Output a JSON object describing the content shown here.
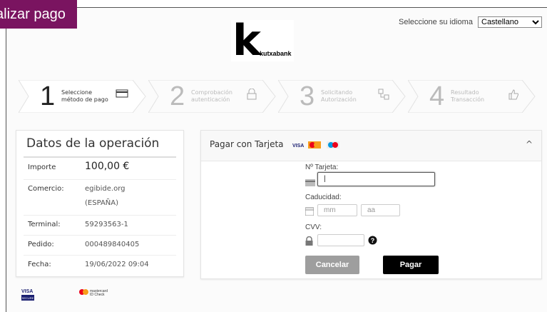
{
  "page": {
    "overlay_label": "alizar pago"
  },
  "language": {
    "label": "Seleccione su idioma",
    "selected": "Castellano"
  },
  "brand": {
    "logo_letter": "k",
    "logo_text": "kutxabank"
  },
  "steps": [
    {
      "num": "1",
      "label": "Seleccione\nmétodo de pago",
      "state": "active",
      "icon": "card-icon"
    },
    {
      "num": "2",
      "label": "Comprobación\nautenticación",
      "state": "inactive",
      "icon": "lock-icon"
    },
    {
      "num": "3",
      "label": "Solicitando\nAutorización",
      "state": "inactive",
      "icon": "network-icon"
    },
    {
      "num": "4",
      "label": "Resultado\nTransacción",
      "state": "inactive",
      "icon": "thumbs-up-icon"
    }
  ],
  "operation": {
    "title": "Datos de la operación",
    "rows": [
      {
        "key": "Importe",
        "value": "100,00 €"
      },
      {
        "key": "Comercio:",
        "value": "egibide.org",
        "value2": "(ESPAÑA)"
      },
      {
        "key": "Terminal:",
        "value": "59293563-1"
      },
      {
        "key": "Pedido:",
        "value": "000489840405"
      },
      {
        "key": "Fecha:",
        "value": "19/06/2022  09:04"
      }
    ]
  },
  "payment": {
    "title": "Pagar con Tarjeta",
    "brands": [
      "VISA",
      "Mastercard",
      "Maestro"
    ],
    "card_label": "Nº Tarjeta:",
    "card_value": "",
    "expiry_label": "Caducidad:",
    "month_placeholder": "mm",
    "year_placeholder": "aa",
    "cvv_label": "CVV:",
    "cvv_value": "",
    "cancel_label": "Cancelar",
    "pay_label": "Pagar"
  },
  "footer": {
    "visa_text": "VISA",
    "visa_sub": "SECURE",
    "mc_text": "mastercard",
    "mc_sub": "ID Check"
  },
  "colors": {
    "overlay": "#7a1460",
    "pay_button": "#000000",
    "cancel_button": "#9e9e9e"
  }
}
